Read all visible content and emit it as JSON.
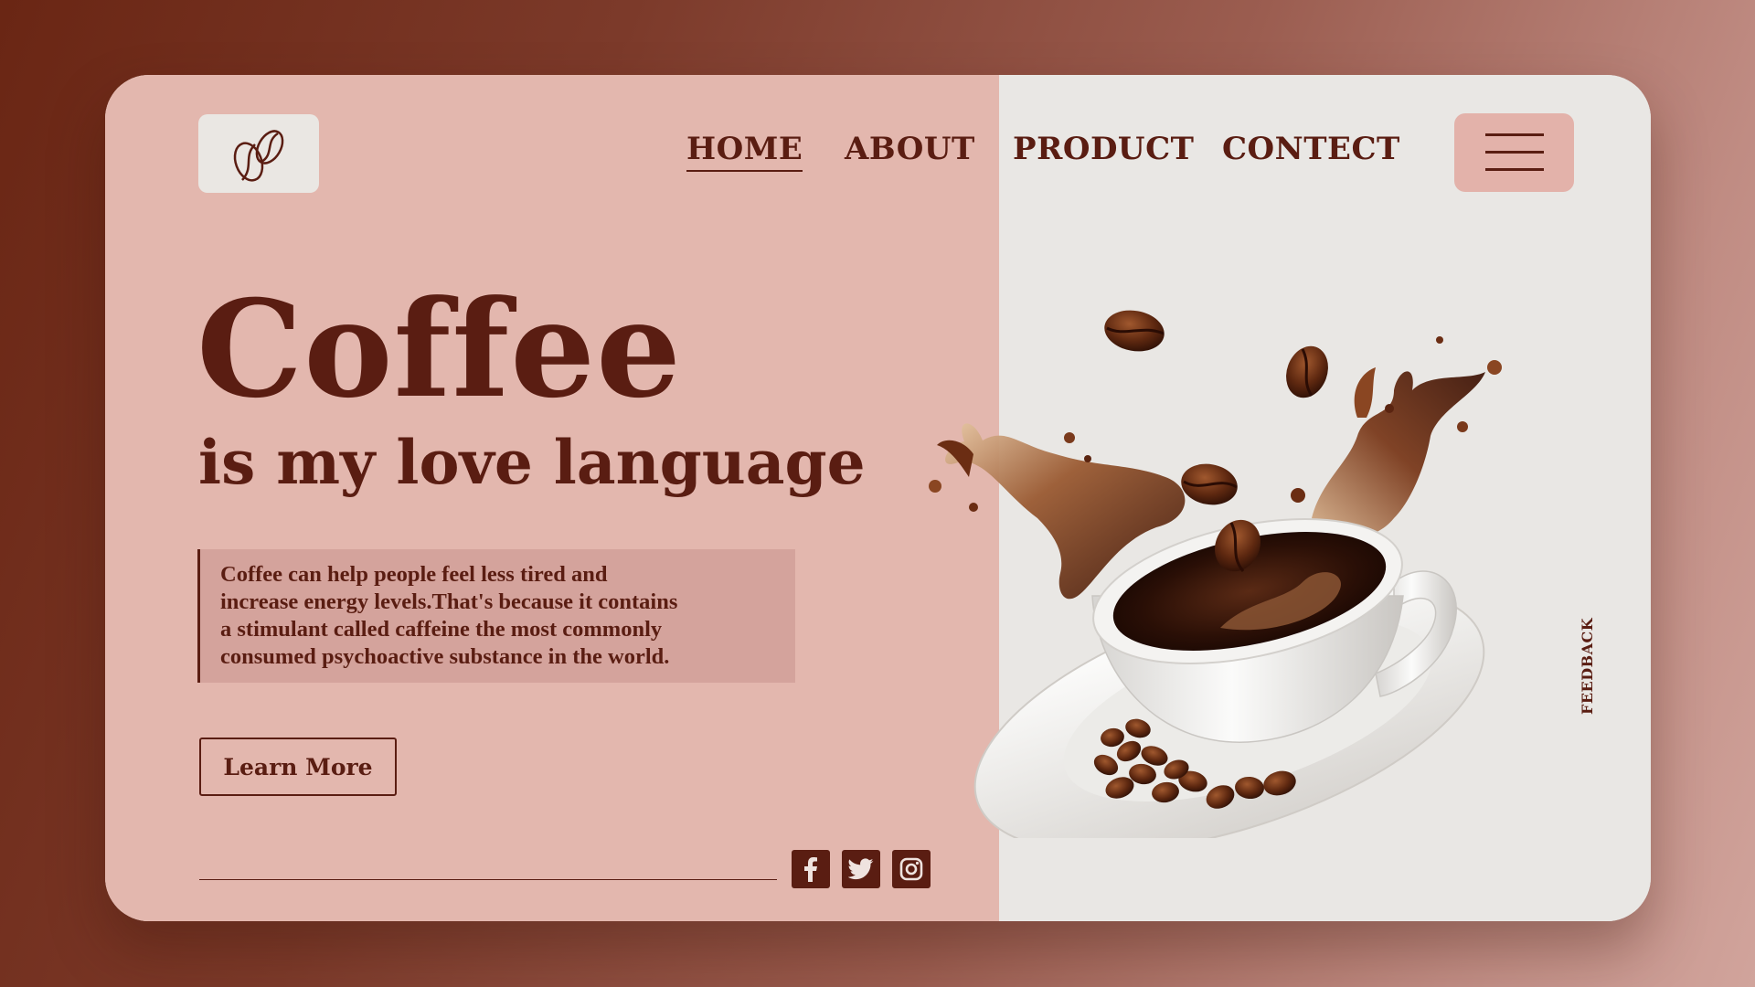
{
  "nav": {
    "items": [
      {
        "label": "HOME",
        "active": true
      },
      {
        "label": "ABOUT",
        "active": false
      },
      {
        "label": "PRODUCT",
        "active": false
      },
      {
        "label": "CONTECT",
        "active": false
      }
    ]
  },
  "hero": {
    "title": "Coffee",
    "subtitle": "is my love language",
    "description_lines": [
      "Coffee can help people feel less tired and",
      "increase energy levels.That's because it contains",
      "a stimulant called caffeine  the most commonly",
      "consumed psychoactive substance in the world."
    ],
    "cta_label": "Learn More"
  },
  "social": {
    "icons": [
      "facebook-icon",
      "twitter-icon",
      "instagram-icon"
    ]
  },
  "feedback_label": "FEEDBACK",
  "colors": {
    "primary": "#5a1d12",
    "left_panel": "#e3b7ae",
    "right_panel": "#e9e7e4",
    "desc_box": "#d4a39c",
    "menu_button": "#e3b2aa"
  },
  "icons": {
    "logo": "coffee-bean-logo-icon",
    "menu": "hamburger-menu-icon",
    "hero_image": "coffee-cup-splash-image"
  }
}
